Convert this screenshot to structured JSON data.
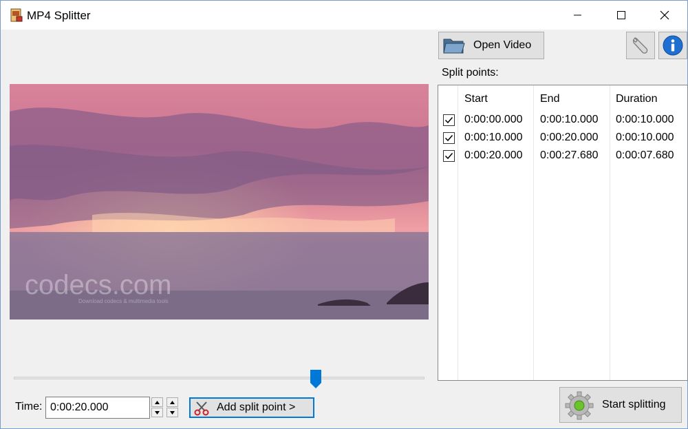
{
  "window": {
    "title": "MP4 Splitter"
  },
  "toolbar": {
    "open_video_label": "Open Video"
  },
  "split_points": {
    "label": "Split points:",
    "columns": [
      "Start",
      "End",
      "Duration"
    ],
    "rows": [
      {
        "checked": true,
        "start": "0:00:00.000",
        "end": "0:00:10.000",
        "duration": "0:00:10.000"
      },
      {
        "checked": true,
        "start": "0:00:10.000",
        "end": "0:00:20.000",
        "duration": "0:00:10.000"
      },
      {
        "checked": true,
        "start": "0:00:20.000",
        "end": "0:00:27.680",
        "duration": "0:00:07.680"
      }
    ]
  },
  "video": {
    "watermark": "codecs.com",
    "watermark_sub": "Download codecs & multimedia tools"
  },
  "playback": {
    "position_fraction": 0.735
  },
  "time": {
    "label": "Time:",
    "value": "0:00:20.000"
  },
  "actions": {
    "add_split_label": "Add split point >",
    "start_splitting_label": "Start splitting"
  },
  "colors": {
    "accent": "#0078d7",
    "info": "#1e6fd0"
  }
}
